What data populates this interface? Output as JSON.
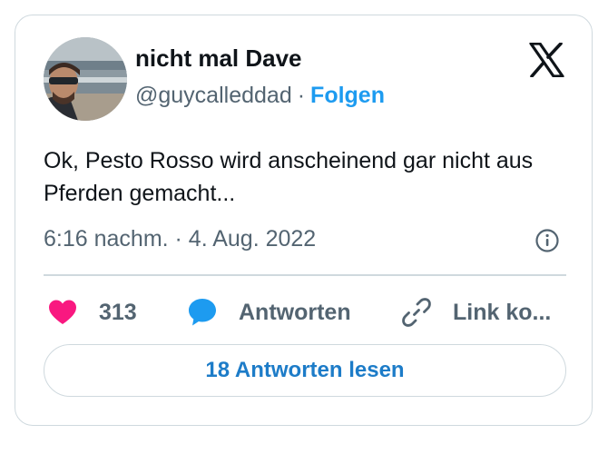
{
  "author": {
    "display_name": "nicht mal Dave",
    "handle": "@guycalleddad",
    "separator": "·",
    "follow_label": "Folgen"
  },
  "tweet": {
    "text": "Ok, Pesto Rosso wird anscheinend gar nicht aus Pferden gemacht...",
    "timestamp": "6:16 nachm. · 4. Aug. 2022"
  },
  "actions": {
    "like_count": "313",
    "reply_label": "Antworten",
    "copy_link_label": "Link ko..."
  },
  "read_replies_label": "18 Antworten lesen",
  "icons": {
    "logo": "x-logo-icon",
    "avatar": "avatar",
    "info": "info-icon",
    "like": "heart-icon",
    "reply": "speech-bubble-icon",
    "copy_link": "link-icon"
  },
  "colors": {
    "accent": "#1d9bf0",
    "like": "#f91880",
    "reply": "#1d9bf0",
    "text_secondary": "#536471",
    "border": "#cfd9de"
  }
}
